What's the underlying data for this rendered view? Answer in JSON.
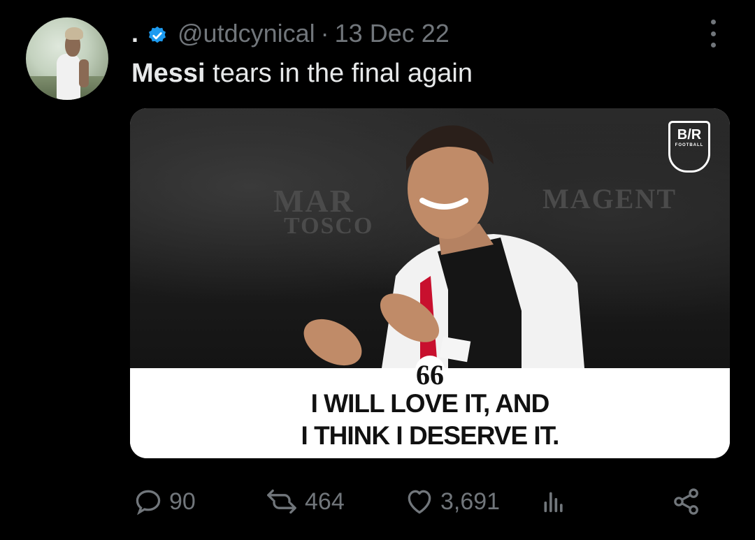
{
  "tweet": {
    "display_name": ".",
    "handle": "@utdcynical",
    "separator": "·",
    "date": "13 Dec 22",
    "text_bold": "Messi",
    "text_rest": " tears in the final again",
    "media": {
      "banner_left": "MAR",
      "banner_left2": "TOSCO",
      "banner_right": "MAGENT",
      "logo_text": "B/R",
      "logo_sub": "FOOTBALL",
      "quote_mark": "66",
      "quote_line1": "I WILL LOVE IT, AND",
      "quote_line2": "I THINK I DESERVE IT."
    },
    "stats": {
      "replies": "90",
      "retweets": "464",
      "likes": "3,691"
    }
  },
  "colors": {
    "background": "#000000",
    "text": "#e7e9ea",
    "muted": "#71767b",
    "verified": "#1d9bf0"
  }
}
